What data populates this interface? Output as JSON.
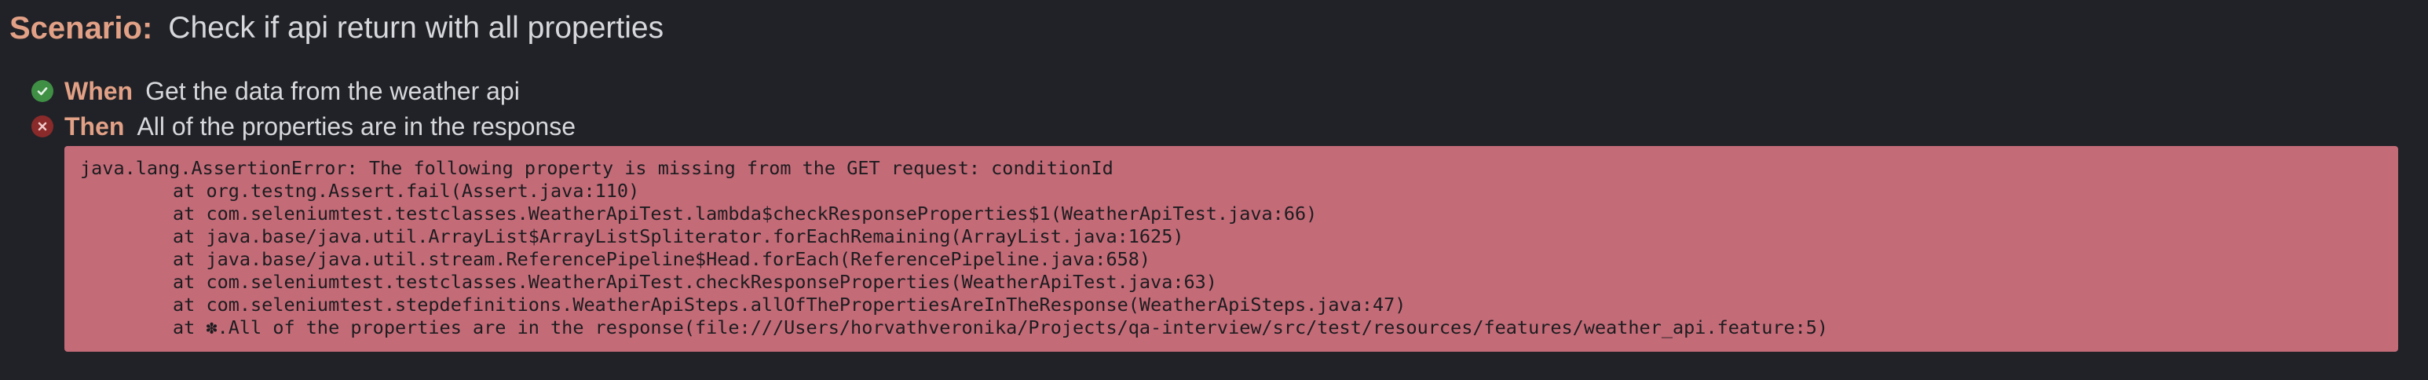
{
  "scenario": {
    "keyword": "Scenario:",
    "title": "Check if api return with all properties"
  },
  "steps": [
    {
      "status": "passed",
      "icon": "check-circle-icon",
      "keyword": "When",
      "text": "Get the data from the weather api"
    },
    {
      "status": "failed",
      "icon": "x-circle-icon",
      "keyword": "Then",
      "text": "All of the properties are in the response"
    }
  ],
  "error": {
    "message": "java.lang.AssertionError: The following property is missing from the GET request: conditionId",
    "stack": [
      "at org.testng.Assert.fail(Assert.java:110)",
      "at com.seleniumtest.testclasses.WeatherApiTest.lambda$checkResponseProperties$1(WeatherApiTest.java:66)",
      "at java.base/java.util.ArrayList$ArrayListSpliterator.forEachRemaining(ArrayList.java:1625)",
      "at java.base/java.util.stream.ReferencePipeline$Head.forEach(ReferencePipeline.java:658)",
      "at com.seleniumtest.testclasses.WeatherApiTest.checkResponseProperties(WeatherApiTest.java:63)",
      "at com.seleniumtest.stepdefinitions.WeatherApiSteps.allOfThePropertiesAreInTheResponse(WeatherApiSteps.java:47)",
      "at ✽.All of the properties are in the response(file:///Users/horvathveronika/Projects/qa-interview/src/test/resources/features/weather_api.feature:5)"
    ]
  },
  "colors": {
    "background": "#212227",
    "keyword": "#e2a186",
    "text": "#d7d8dc",
    "passed": "#3f8f45",
    "failed": "#8a2a2a",
    "error_background": "#c46b78"
  }
}
